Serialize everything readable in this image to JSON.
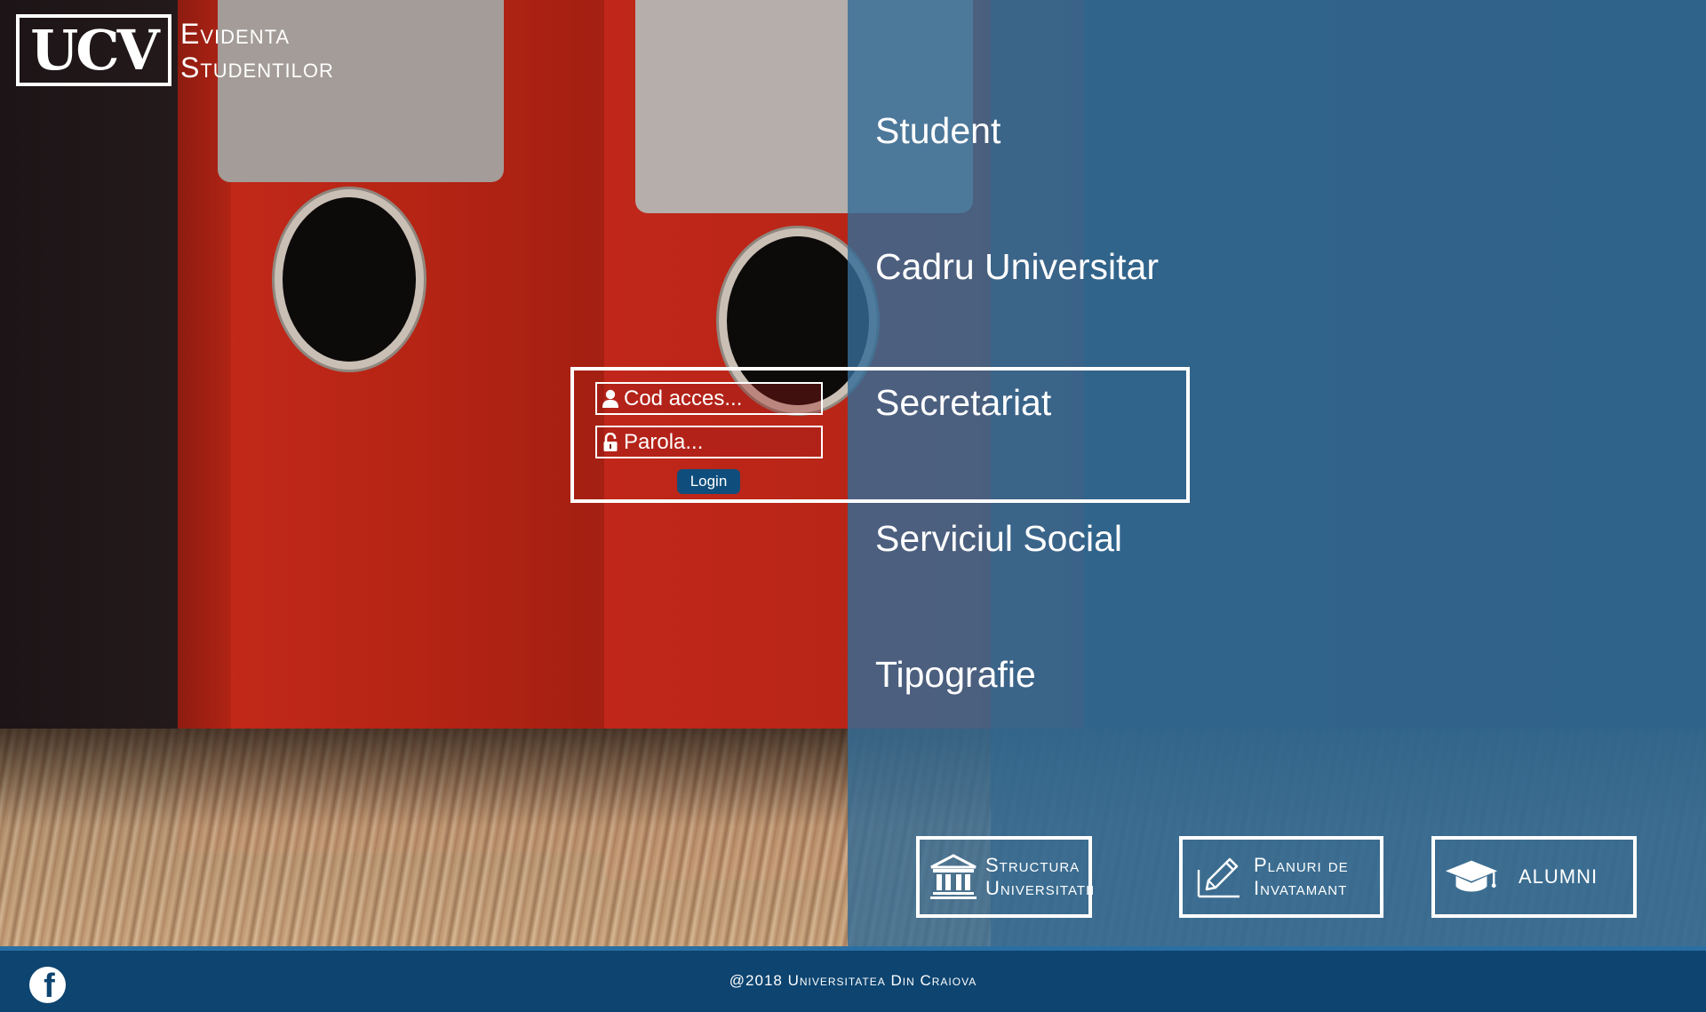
{
  "header": {
    "logo_mark": "UCV",
    "title_line1": "Evidenta",
    "title_line2": "Studentilor"
  },
  "nav": {
    "items": [
      {
        "label": "Student"
      },
      {
        "label": "Cadru Universitar"
      },
      {
        "label": "Secretariat"
      },
      {
        "label": "Serviciul Social"
      },
      {
        "label": "Tipografie"
      }
    ]
  },
  "login": {
    "code_placeholder": "Cod acces...",
    "password_placeholder": "Parola...",
    "button_label": "Login",
    "user_icon": "user-icon",
    "lock_icon": "lock-icon"
  },
  "tiles": [
    {
      "line1": "Structura",
      "line2": "Universitatii",
      "icon": "institution-icon"
    },
    {
      "line1": "Planuri de",
      "line2": "Invatamant",
      "icon": "pencil-icon"
    },
    {
      "line1": "ALUMNI",
      "line2": "",
      "icon": "graduation-cap-icon"
    }
  ],
  "footer": {
    "copyright": "@2018 Universitatea Din Craiova",
    "social_icon": "facebook-icon"
  },
  "colors": {
    "overlay_blue": "#346c96",
    "footer_blue": "#0d4470",
    "button_blue": "#0f4e7c",
    "binder_red": "#c52a1a"
  }
}
